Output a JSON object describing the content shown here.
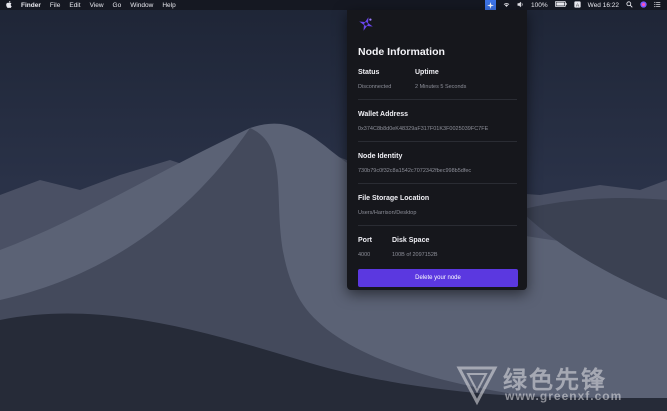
{
  "menubar": {
    "app_name": "Finder",
    "menus": [
      "File",
      "Edit",
      "View",
      "Go",
      "Window",
      "Help"
    ],
    "battery": "100%",
    "clock": "Wed 16:22"
  },
  "panel": {
    "title": "Node Information",
    "status": {
      "label": "Status",
      "value": "Disconnected"
    },
    "uptime": {
      "label": "Uptime",
      "value": "2 Minutes 5 Seconds"
    },
    "wallet": {
      "label": "Wallet Address",
      "value": "0x374C8b8d0eK48329aF317F01K3F0025039FC7FE"
    },
    "node_identity": {
      "label": "Node Identity",
      "value": "730b79c0f32c8a1542c7072342fbec998b5dfec"
    },
    "storage": {
      "label": "File Storage Location",
      "value": "Users/Harrison/Desktop"
    },
    "port": {
      "label": "Port",
      "value": "4000"
    },
    "disk_space": {
      "label": "Disk Space",
      "value": "100B of 2097152B"
    },
    "delete_label": "Delete your node"
  },
  "watermark": {
    "text": "绿色先锋",
    "url": "www.greenxf.com"
  },
  "colors": {
    "panel_bg": "#16171c",
    "accent_button": "#5b38e0",
    "tray_highlight": "#3d74e8"
  }
}
